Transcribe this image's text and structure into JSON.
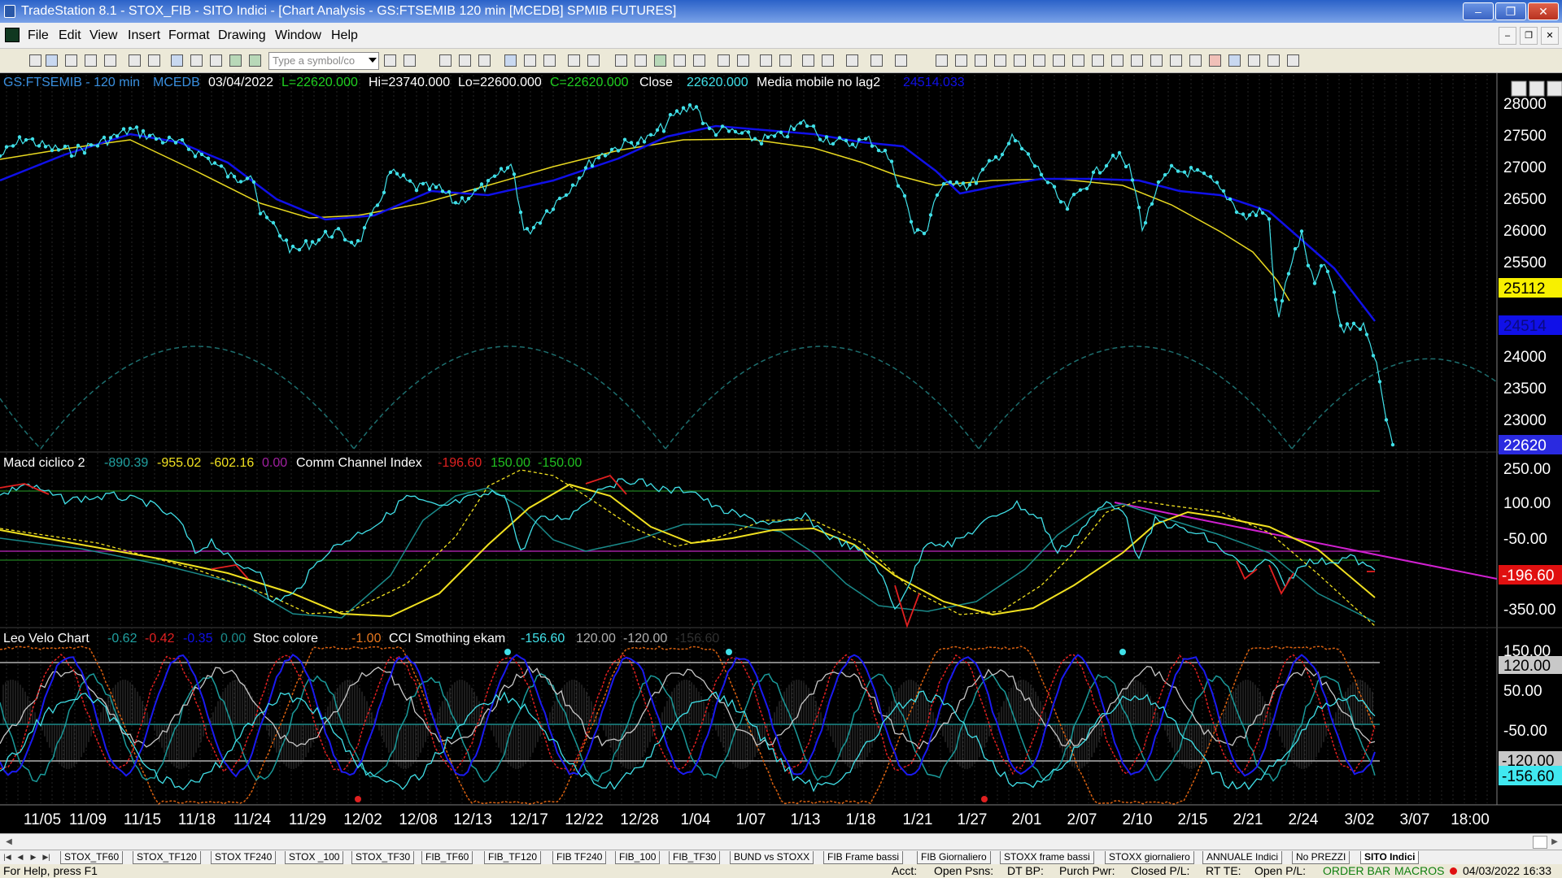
{
  "window": {
    "title": "TradeStation 8.1 - STOX_FIB - SITO Indici - [Chart Analysis - GS:FTSEMIB  120 min  [MCEDB] SPMIB FUTURES]"
  },
  "menu": [
    "File",
    "Edit",
    "View",
    "Insert",
    "Format",
    "Drawing",
    "Window",
    "Help"
  ],
  "toolbar": {
    "symbol_placeholder": "Type a symbol/co"
  },
  "chart": {
    "header": {
      "symbol": "GS:FTSEMIB - 120 min",
      "feed": "MCEDB",
      "date": "03/04/2022",
      "low_open": "L=22620.000",
      "high": "Hi=23740.000",
      "low": "Lo=22600.000",
      "close_val": "C=22620.000",
      "close_label": "Close",
      "close_num": "22620.000",
      "ma_label": "Media mobile no lag2",
      "ma_val": "24514.033"
    },
    "panel1_axis": [
      "28000",
      "27500",
      "27000",
      "26500",
      "26000",
      "25500",
      "24000",
      "23500",
      "23000"
    ],
    "panel1_tags": {
      "yellow": "25112",
      "blue": "24514",
      "price": "22620"
    },
    "macd_header": {
      "name": "Macd ciclico 2",
      "v1": "-890.39",
      "v2": "-955.02",
      "v3": "-602.16",
      "v4": "0.00",
      "cci_name": "Comm Channel Index",
      "cci_v": "-196.60",
      "cci_hi": "150.00",
      "cci_lo": "-150.00"
    },
    "panel2_axis": [
      "250.00",
      "100.00",
      "-50.00",
      "-350.00"
    ],
    "panel2_tags": {
      "cci": "-196.60"
    },
    "leo_header": {
      "name": "Leo Velo Chart",
      "v1": "-0.62",
      "v2": "-0.42",
      "v3": "-0.35",
      "v4": "0.00",
      "stoc": "Stoc colore",
      "stoc_v": "-1.00",
      "cci_s": "CCI Smothing ekam",
      "cci_s_v": "-156.60",
      "v5": "120.00",
      "v6": "-120.00",
      "v7": "-156.60"
    },
    "panel3_axis": [
      "150.00",
      "50.00",
      "-50.00"
    ],
    "panel3_tags": {
      "hi": "120.00",
      "lo": "-120.00",
      "cci": "-156.60"
    },
    "dates": [
      "11/05",
      "11/09",
      "11/15",
      "11/18",
      "11/24",
      "11/29",
      "12/02",
      "12/08",
      "12/13",
      "12/17",
      "12/22",
      "12/28",
      "1/04",
      "1/07",
      "1/13",
      "1/18",
      "1/21",
      "1/27",
      "2/01",
      "2/07",
      "2/10",
      "2/15",
      "2/21",
      "2/24",
      "3/02",
      "3/07",
      "18:00"
    ]
  },
  "tabs": [
    "STOX_TF60",
    "STOX_TF120",
    "STOX TF240",
    "STOX _100",
    "STOX_TF30",
    "FIB_TF60",
    "FIB_TF120",
    "FIB TF240",
    "FIB_100",
    "FIB_TF30",
    "BUND vs STOXX",
    "FIB Frame bassi",
    "FIB Giornaliero",
    "STOXX frame bassi",
    "STOXX giornaliero",
    "ANNUALE Indici",
    "No PREZZI",
    "SITO Indici"
  ],
  "status": {
    "help": "For Help, press F1",
    "acct": "Acct:",
    "open_psns": "Open Psns:",
    "dt_bp": "DT BP:",
    "purch": "Purch Pwr:",
    "closed_pl": "Closed P/L:",
    "rt_te": "RT TE:",
    "open_pl": "Open P/L:",
    "order_bar": "ORDER BAR",
    "macros": "MACROS",
    "datetime": "04/03/2022 16:33"
  },
  "colors": {
    "cyan": "#40e0e8",
    "yellow": "#f0e020",
    "blue": "#1010e8",
    "red": "#e02020",
    "green": "#20c020",
    "magenta": "#d020d0",
    "teal": "#20a0a0"
  }
}
